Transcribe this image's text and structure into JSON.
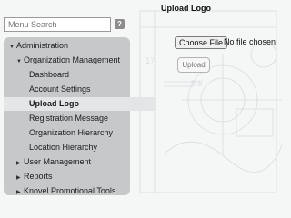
{
  "search": {
    "placeholder": "Menu Search",
    "help_icon": "?"
  },
  "sidebar": {
    "items": [
      {
        "label": "Administration",
        "state": "expanded"
      },
      {
        "label": "Organization Management",
        "state": "expanded"
      },
      {
        "label": "Dashboard",
        "state": "leaf"
      },
      {
        "label": "Account Settings",
        "state": "leaf"
      },
      {
        "label": "Upload Logo",
        "state": "selected"
      },
      {
        "label": "Registration Message",
        "state": "leaf"
      },
      {
        "label": "Organization Hierarchy",
        "state": "leaf"
      },
      {
        "label": "Location Hierarchy",
        "state": "leaf"
      },
      {
        "label": "User Management",
        "state": "collapsed"
      },
      {
        "label": "Reports",
        "state": "collapsed"
      },
      {
        "label": "Knovel Promotional Tools",
        "state": "collapsed"
      }
    ]
  },
  "main": {
    "title": "Upload Logo",
    "choose_file_label": "Choose File",
    "file_status": "No file chosen",
    "upload_label": "Upload"
  },
  "icons": {
    "expanded": "caret-down-icon",
    "collapsed": "caret-right-icon"
  }
}
